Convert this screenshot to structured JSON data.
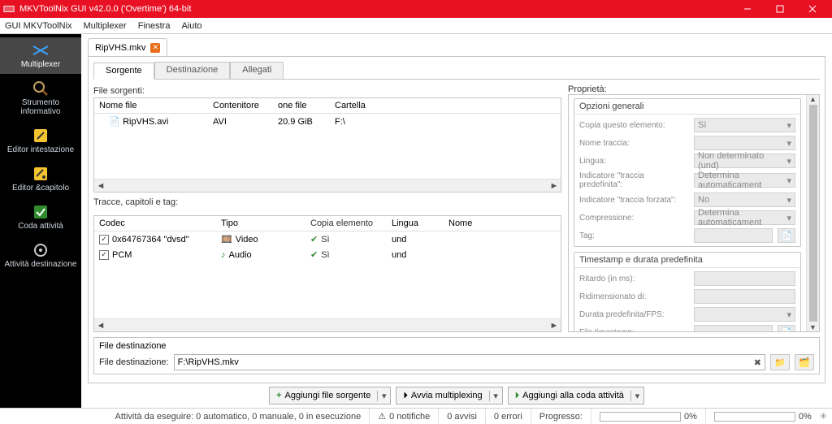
{
  "title": "MKVToolNix GUI v42.0.0 ('Overtime') 64-bit",
  "menubar": [
    "GUI MKVToolNix",
    "Multiplexer",
    "Finestra",
    "Aiuto"
  ],
  "sidebar": [
    {
      "label": "Multiplexer",
      "active": true,
      "color": "#3da1ff"
    },
    {
      "label": "Strumento informativo",
      "active": false
    },
    {
      "label": "Editor intestazione",
      "active": false
    },
    {
      "label": "Editor &capitolo",
      "active": false
    },
    {
      "label": "Coda attività",
      "active": false
    },
    {
      "label": "Attività destinazione",
      "active": false
    }
  ],
  "tab": {
    "label": "RipVHS.mkv"
  },
  "subtabs": [
    "Sorgente",
    "Destinazione",
    "Allegati"
  ],
  "source": {
    "filesLabel": "File sorgenti:",
    "headers": {
      "name": "Nome file",
      "cont": "Contenitore",
      "one": "one file",
      "dir": "Cartella"
    },
    "row": {
      "name": "RipVHS.avi",
      "cont": "AVI",
      "one": "20.9 GiB",
      "dir": "F:\\"
    },
    "tracksLabel": "Tracce, capitoli e tag:",
    "trackHeaders": {
      "codec": "Codec",
      "type": "Tipo",
      "copy": "Copia elemento",
      "lang": "Lingua",
      "name": "Nome"
    },
    "tracks": [
      {
        "codec": "0x64767364 \"dvsd\"",
        "type": "Video",
        "copy": "Sì",
        "lang": "und",
        "name": ""
      },
      {
        "codec": "PCM",
        "type": "Audio",
        "copy": "Sì",
        "lang": "und",
        "name": ""
      }
    ]
  },
  "properties": {
    "title": "Proprietà:",
    "general": {
      "group": "Opzioni generali",
      "copy": {
        "label": "Copia questo elemento:",
        "value": "Sì"
      },
      "name": {
        "label": "Nome traccia:",
        "value": ""
      },
      "lang": {
        "label": "Lingua:",
        "value": "Non determinato (und)"
      },
      "default": {
        "label": "Indicatore \"traccia predefinita\":",
        "value": "Determina automaticament"
      },
      "forced": {
        "label": "Indicatore \"traccia forzata\":",
        "value": "No"
      },
      "comp": {
        "label": "Compressione:",
        "value": "Determina automaticament"
      },
      "tag": {
        "label": "Tag:",
        "value": ""
      }
    },
    "timestamps": {
      "group": "Timestamp e durata predefinita",
      "delay": {
        "label": "Ritardo (in ms):",
        "value": ""
      },
      "scale": {
        "label": "Ridimensionato di:",
        "value": ""
      },
      "fps": {
        "label": "Durata predefinita/FPS:",
        "value": ""
      },
      "ts": {
        "label": "File timestamp:",
        "value": ""
      }
    }
  },
  "dest": {
    "title": "File destinazione",
    "label": "File destinazione:",
    "value": "F:\\RipVHS.mkv"
  },
  "actions": {
    "add": "Aggiungi file sorgente",
    "start": "Avvia multiplexing",
    "queue": "Aggiungi alla coda attività"
  },
  "status": {
    "jobs": "Attività da eseguire: 0 automatico, 0 manuale, 0 in esecuzione",
    "notify": "0 notifiche",
    "warn": "0 avvisi",
    "err": "0 errori",
    "progLabel": "Progresso:",
    "p1": "0%",
    "p2": "0%"
  }
}
